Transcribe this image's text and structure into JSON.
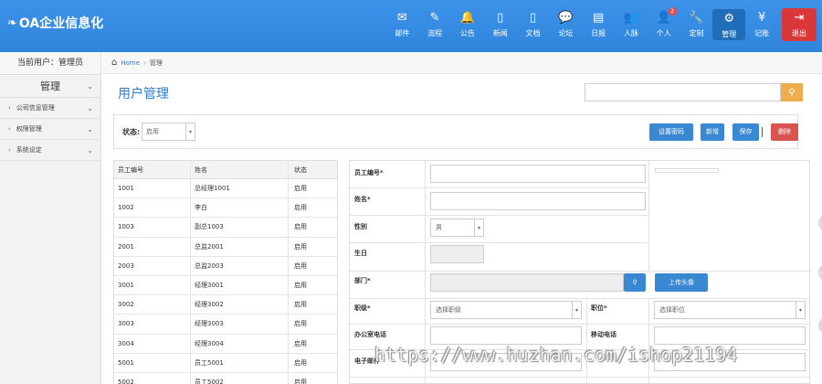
{
  "app": {
    "title": "OA企业信息化"
  },
  "nav": [
    {
      "label": "邮件",
      "icon": "mail-icon",
      "glyph": "✉"
    },
    {
      "label": "流程",
      "icon": "pencil-icon",
      "glyph": "✎"
    },
    {
      "label": "公告",
      "icon": "bell-icon",
      "glyph": "🔔"
    },
    {
      "label": "新闻",
      "icon": "document-icon",
      "glyph": "▯"
    },
    {
      "label": "文档",
      "icon": "file-icon",
      "glyph": "▯"
    },
    {
      "label": "论坛",
      "icon": "chat-icon",
      "glyph": "💬"
    },
    {
      "label": "日报",
      "icon": "book-icon",
      "glyph": "▤"
    },
    {
      "label": "人脉",
      "icon": "group-icon",
      "glyph": "👥"
    },
    {
      "label": "个人",
      "icon": "user-icon",
      "glyph": "👤",
      "badge": "2"
    },
    {
      "label": "定制",
      "icon": "wrench-icon",
      "glyph": "🔧"
    },
    {
      "label": "管理",
      "icon": "gears-icon",
      "glyph": "⚙",
      "active": true
    },
    {
      "label": "记账",
      "icon": "yen-icon",
      "glyph": "¥"
    },
    {
      "label": "退出",
      "icon": "logout-icon",
      "glyph": "⇥",
      "exit": true
    }
  ],
  "sidebar": {
    "current_user": "当前用户：管理员",
    "heading": "管理",
    "items": [
      {
        "label": "公司信息管理"
      },
      {
        "label": "权限管理"
      },
      {
        "label": "系统设定"
      }
    ]
  },
  "breadcrumb": {
    "home": "Home",
    "current": "管理"
  },
  "page": {
    "title": "用户管理"
  },
  "search": {
    "placeholder": ""
  },
  "filter": {
    "status_label": "状态:",
    "status_value": "启用",
    "buttons": {
      "set_password": "设置密码",
      "add": "新增",
      "save": "保存",
      "delete": "删除"
    }
  },
  "table": {
    "headers": [
      "员工编号",
      "姓名",
      "状态"
    ],
    "rows": [
      [
        "1001",
        "总经理1001",
        "启用"
      ],
      [
        "1002",
        "李白",
        "启用"
      ],
      [
        "1003",
        "副总1003",
        "启用"
      ],
      [
        "2001",
        "总监2001",
        "启用"
      ],
      [
        "2003",
        "总监2003",
        "启用"
      ],
      [
        "3001",
        "经理3001",
        "启用"
      ],
      [
        "3002",
        "经理3002",
        "启用"
      ],
      [
        "3003",
        "经理3003",
        "启用"
      ],
      [
        "3004",
        "经理3004",
        "启用"
      ],
      [
        "5001",
        "员工5001",
        "启用"
      ],
      [
        "5002",
        "员工5002",
        "启用"
      ]
    ]
  },
  "form": {
    "employee_no_label": "员工编号*",
    "name_label": "姓名*",
    "gender_label": "性别",
    "gender_value": "男",
    "birthday_label": "生日",
    "dept_label": "部门*",
    "upload_avatar": "上传头像",
    "rank_label": "职级*",
    "rank_placeholder": "选择职级",
    "position_label": "职位*",
    "position_placeholder": "选择职位",
    "office_phone_label": "办公室电话",
    "mobile_label": "移动电话",
    "email_label": "电子邮件"
  },
  "watermark": "https://www.huzhan.com/ishop21194",
  "colors": {
    "topbar": "#3a8ee6",
    "accent": "#2a7ed3",
    "button": "#3a87d4",
    "danger": "#d9534f",
    "search": "#f0ad4e"
  }
}
